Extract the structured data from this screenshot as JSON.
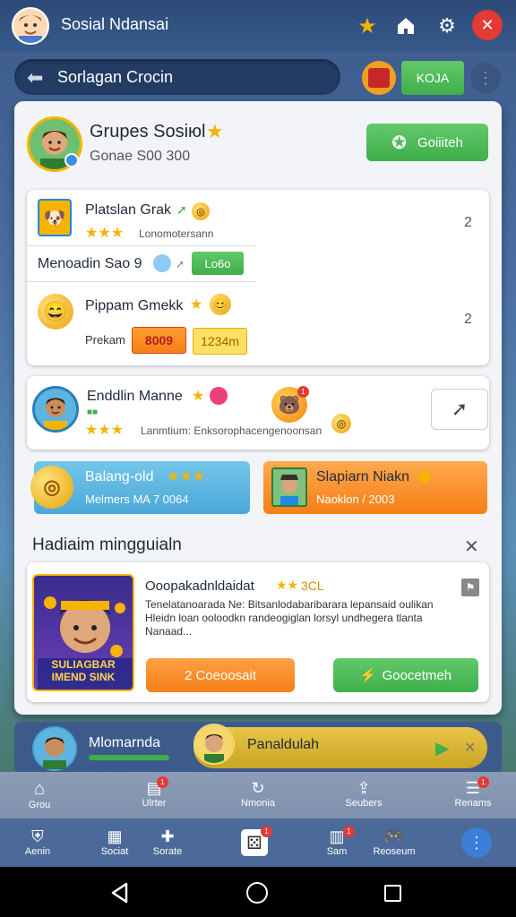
{
  "app": {
    "title": "Sosial Ndansai"
  },
  "search": {
    "text": "Sorlagan Crocin",
    "action_label": "KOJA"
  },
  "group": {
    "name": "Grupes Sosiюl",
    "members": "Gonae S00 300",
    "follow_label": "Goiiiteh"
  },
  "items": [
    {
      "title": "Platslan Grak",
      "subtitle": "Lonomotersann",
      "count": "2"
    },
    {
      "title": "Pippam Gmekk",
      "count": "2"
    }
  ],
  "row_mid": {
    "text": "Menoadin Sao 9",
    "tag": "Lo6o"
  },
  "row_price": {
    "label": "Prekam",
    "price1": "8009",
    "price2": "1234m"
  },
  "profile": {
    "name": "Enddlin Manne",
    "subtitle": "Lanmtium: Enksorophacengenoonsan",
    "progress_label": "■■"
  },
  "tiles": [
    {
      "title": "Balang-old",
      "subtitle": "Melmers MA 7 0064"
    },
    {
      "title": "Slapiarn Niakn",
      "subtitle": "Naoklon / 2003"
    }
  ],
  "section": {
    "title": "Hadiaim mingguialn"
  },
  "promo": {
    "title": "Ooopakadnldaidat",
    "rating": "3CL",
    "desc": "Tenelatanoarada Ne: Bitsanlodabaribarara lepansaid oulikan Hleidn loan ooloodkn randeogiglan lorsyl undhegera tlanta Nanaad...",
    "image_text": "SULIAGBAR IMEND SINK",
    "btn_left": "2 Coeoosait",
    "btn_right": "Goocetmeh"
  },
  "bottom": {
    "name": "Mlomarnda",
    "highlight": "Panaldulah"
  },
  "nav_top": [
    {
      "label": "Grou",
      "icon": "home-icon"
    },
    {
      "label": "Ulrter",
      "icon": "cart-icon"
    },
    {
      "label": "Nmonia",
      "icon": "refresh-icon"
    },
    {
      "label": "Seubers",
      "icon": "share-icon"
    },
    {
      "label": "Renams",
      "icon": "list-icon"
    }
  ],
  "nav_bottom": [
    {
      "label": "Aenin",
      "icon": "shield-icon"
    },
    {
      "label": "Sociat",
      "icon": "calendar-icon"
    },
    {
      "label": "Sorate",
      "icon": "puzzle-icon"
    },
    {
      "label": "",
      "icon": "dice-icon"
    },
    {
      "label": "Sam",
      "icon": "chart-icon"
    },
    {
      "label": "Reoseum",
      "icon": "game-icon"
    }
  ],
  "colors": {
    "accent": "#3fae4b",
    "orange": "#f57f17",
    "close": "#e53935"
  }
}
